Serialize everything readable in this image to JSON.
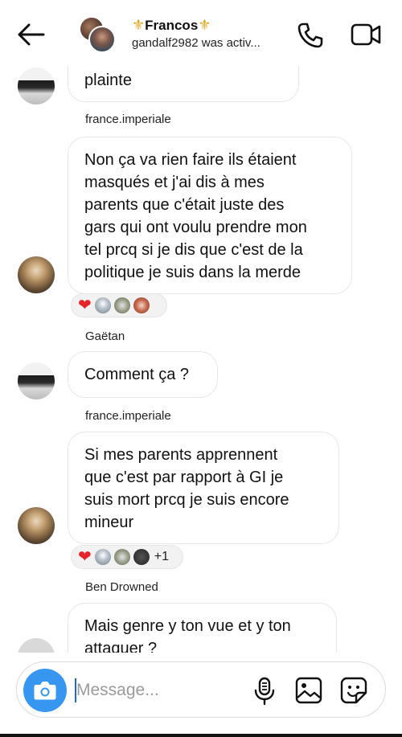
{
  "header": {
    "title": "Francos",
    "fleur_left": "⚜",
    "fleur_right": "⚜",
    "status": "gandalf2982 was activ..."
  },
  "messages": {
    "m1": {
      "text": "plainte"
    },
    "m2": {
      "sender": "france.imperiale",
      "text": "Non ça va rien faire ils étaient\nmasqués et j'ai dis à mes\nparents que c'était juste des\ngars qui ont voulu prendre mon\ntel prcq si je dis que c'est de la\npolitique je suis dans la merde"
    },
    "m3": {
      "sender": "Gaëtan",
      "text": "Comment ça ?"
    },
    "m4": {
      "sender": "france.imperiale",
      "text": "Si mes parents apprennent\nque c'est par rapport à GI je\nsuis mort prcq je suis encore\nmineur"
    },
    "m5": {
      "sender": "Ben Drowned",
      "text": "Mais genre y ton vue et y ton\nattaquer ?"
    }
  },
  "reactions": {
    "r1_heart": "❤",
    "r2_heart": "❤",
    "r2_more": "+1"
  },
  "composer": {
    "placeholder": "Message..."
  },
  "colors": {
    "accent": "#3797f0",
    "heart": "#e4262a",
    "fleur": "#e3a31a"
  }
}
